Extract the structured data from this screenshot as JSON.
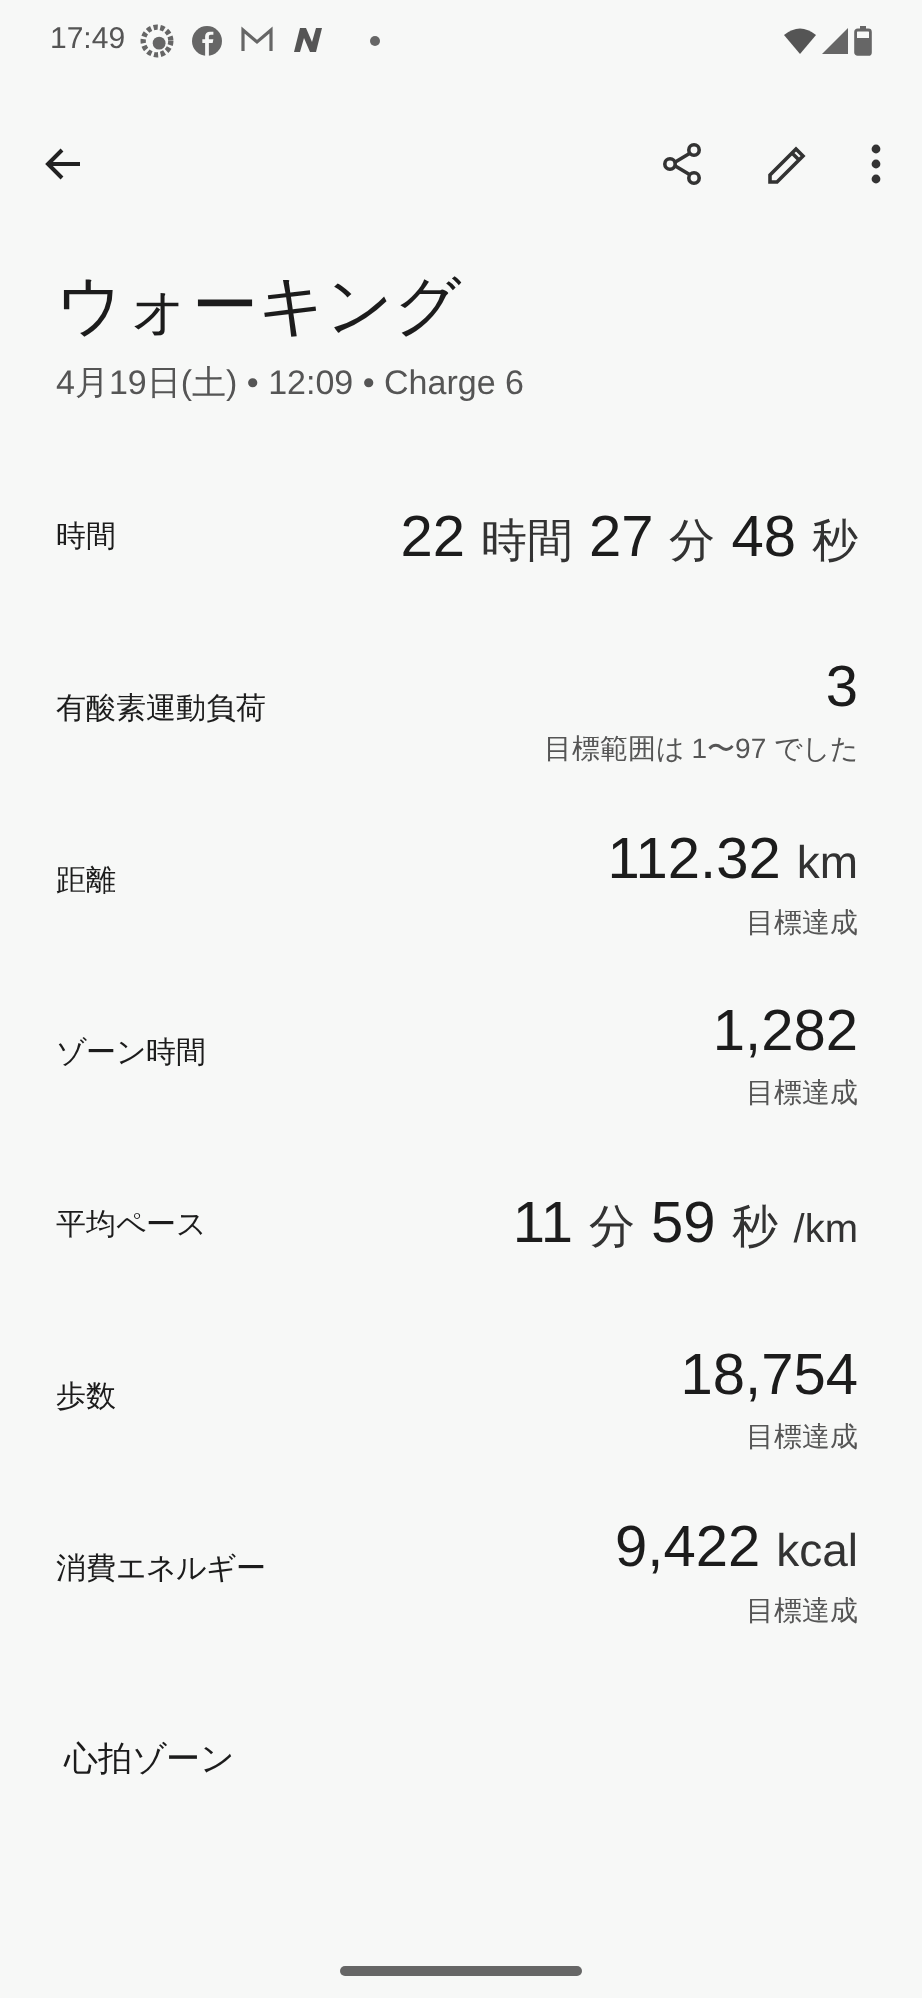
{
  "status_bar": {
    "time": "17:49"
  },
  "title": "ウォーキング",
  "subtitle": "4月19日(土) • 12:09 • Charge 6",
  "metrics": [
    {
      "label": "時間",
      "value": [
        {
          "kind": "num",
          "text": "22"
        },
        {
          "kind": "unit",
          "text": "時間"
        },
        {
          "kind": "num",
          "text": "27"
        },
        {
          "kind": "unit",
          "text": "分"
        },
        {
          "kind": "num",
          "text": "48"
        },
        {
          "kind": "unit",
          "text": "秒"
        }
      ]
    },
    {
      "label": "有酸素運動負荷",
      "value": [
        {
          "kind": "num",
          "text": "3"
        }
      ],
      "note": "目標範囲は 1〜97 でした"
    },
    {
      "label": "距離",
      "value": [
        {
          "kind": "num",
          "text": "112.32"
        },
        {
          "kind": "unit",
          "text": "km"
        }
      ],
      "note": "目標達成"
    },
    {
      "label": "ゾーン時間",
      "value": [
        {
          "kind": "num",
          "text": "1,282"
        }
      ],
      "note": "目標達成"
    },
    {
      "label": "平均ペース",
      "value": [
        {
          "kind": "num",
          "text": "11"
        },
        {
          "kind": "unit",
          "text": "分"
        },
        {
          "kind": "num",
          "text": "59"
        },
        {
          "kind": "unit",
          "text": "秒"
        },
        {
          "kind": "small",
          "text": "/km"
        }
      ]
    },
    {
      "label": "歩数",
      "value": [
        {
          "kind": "num",
          "text": "18,754"
        }
      ],
      "note": "目標達成"
    },
    {
      "label": "消費エネルギー",
      "value": [
        {
          "kind": "num",
          "text": "9,422"
        },
        {
          "kind": "unit",
          "text": "kcal"
        }
      ],
      "note": "目標達成"
    }
  ],
  "section": {
    "title": "心拍ゾーン"
  }
}
